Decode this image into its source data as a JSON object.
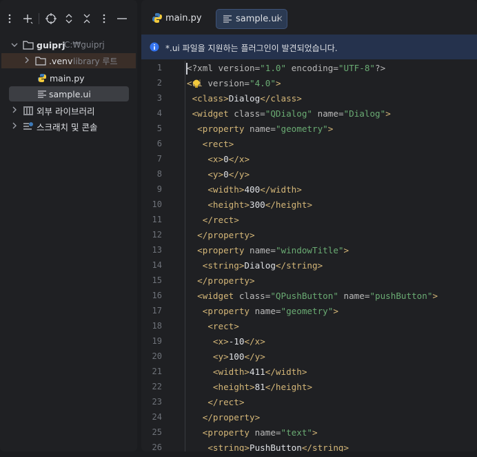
{
  "toolbar": {
    "icons": [
      "more-icon",
      "add-icon",
      "locate-icon",
      "expand-collapse-icon",
      "collapse-all-icon",
      "options-icon",
      "minimize-icon"
    ]
  },
  "tree": {
    "project_name": "guiprj",
    "project_path": "C:₩guiprj",
    "venv_name": ".venv",
    "venv_hint": "library 루트",
    "file_main": "main.py",
    "file_sample": "sample.ui",
    "external_libs": "외부 라이브러리",
    "scratches": "스크래치 및 콘솔"
  },
  "tabs": [
    {
      "label": "main.py",
      "active": false
    },
    {
      "label": "sample.ui",
      "active": true,
      "close": "×"
    }
  ],
  "banner": {
    "icon": "info-icon",
    "text": "*.ui 파일을 지원하는 플러그인이 발견되었습니다."
  },
  "code": {
    "line_numbers": [
      "1",
      "2",
      "3",
      "4",
      "5",
      "6",
      "7",
      "8",
      "9",
      "10",
      "11",
      "12",
      "13",
      "14",
      "15",
      "16",
      "17",
      "18",
      "19",
      "20",
      "21",
      "22",
      "23",
      "24",
      "25",
      "26"
    ],
    "lines": [
      "<?xml version=\"1.0\" encoding=\"UTF-8\"?>",
      "<ui version=\"4.0\">",
      " <class>Dialog</class>",
      " <widget class=\"QDialog\" name=\"Dialog\">",
      "  <property name=\"geometry\">",
      "   <rect>",
      "    <x>0</x>",
      "    <y>0</y>",
      "    <width>400</width>",
      "    <height>300</height>",
      "   </rect>",
      "  </property>",
      "  <property name=\"windowTitle\">",
      "   <string>Dialog</string>",
      "  </property>",
      "  <widget class=\"QPushButton\" name=\"pushButton\">",
      "   <property name=\"geometry\">",
      "    <rect>",
      "     <x>-10</x>",
      "     <y>100</y>",
      "     <width>411</width>",
      "     <height>81</height>",
      "    </rect>",
      "   </property>",
      "   <property name=\"text\">",
      "    <string>PushButton</string>"
    ]
  },
  "colors": {
    "tag": "#d5b778",
    "string": "#6aab73",
    "banner_bg": "#25324d",
    "selection": "#393b40"
  }
}
